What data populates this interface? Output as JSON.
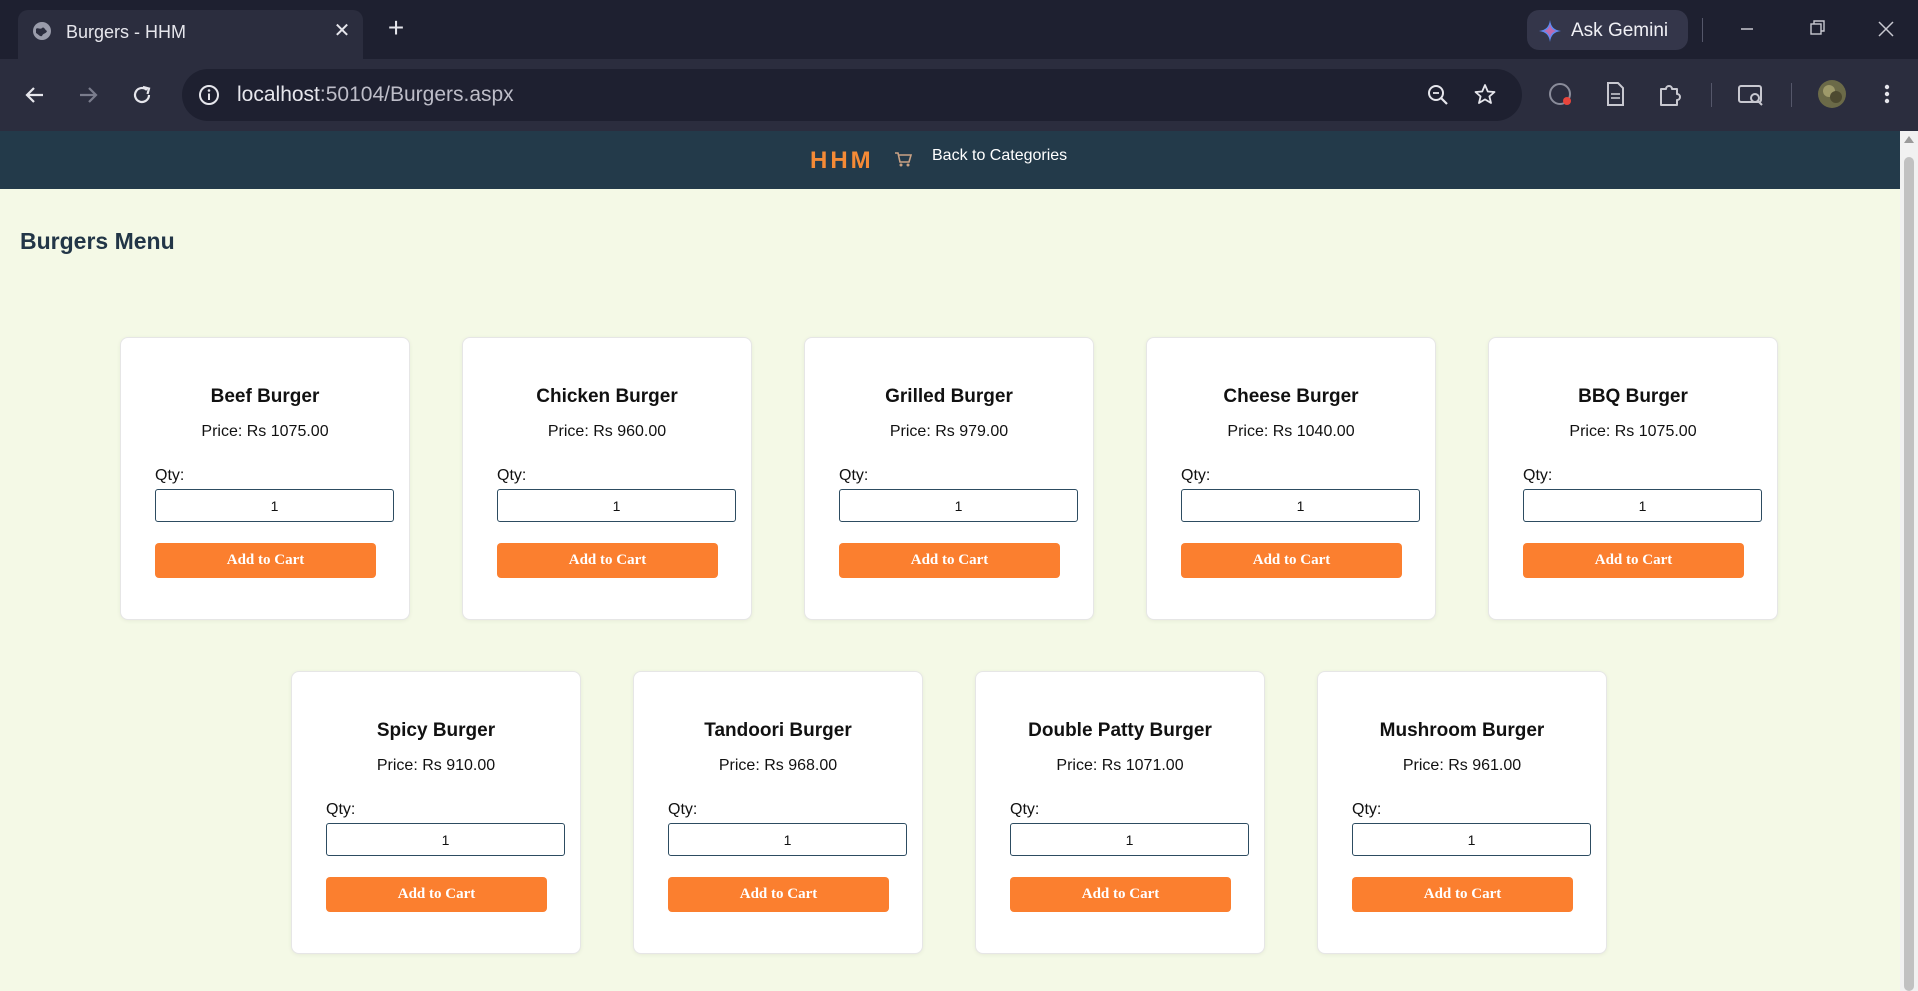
{
  "browser": {
    "tab_title": "Burgers - HHM",
    "new_tab_symbol": "+",
    "close_symbol": "✕",
    "gemini_label": "Ask Gemini",
    "url_host": "localhost",
    "url_rest": ":50104/Burgers.aspx"
  },
  "site": {
    "brand": "HHM",
    "back_link": "Back to Categories",
    "page_title": "Burgers Menu",
    "accent_color": "#fb7f2f",
    "nav_color": "#233a4a",
    "background_color": "#f4f9e6"
  },
  "card_labels": {
    "qty": "Qty:",
    "add_to_cart": "Add to Cart"
  },
  "menu": [
    {
      "name": "Beef Burger",
      "price": "Price: Rs 1075.00",
      "qty": "1"
    },
    {
      "name": "Chicken Burger",
      "price": "Price: Rs 960.00",
      "qty": "1"
    },
    {
      "name": "Grilled Burger",
      "price": "Price: Rs 979.00",
      "qty": "1"
    },
    {
      "name": "Cheese Burger",
      "price": "Price: Rs 1040.00",
      "qty": "1"
    },
    {
      "name": "BBQ Burger",
      "price": "Price: Rs 1075.00",
      "qty": "1"
    },
    {
      "name": "Spicy Burger",
      "price": "Price: Rs 910.00",
      "qty": "1"
    },
    {
      "name": "Tandoori Burger",
      "price": "Price: Rs 968.00",
      "qty": "1"
    },
    {
      "name": "Double Patty Burger",
      "price": "Price: Rs 1071.00",
      "qty": "1"
    },
    {
      "name": "Mushroom Burger",
      "price": "Price: Rs 961.00",
      "qty": "1"
    }
  ]
}
